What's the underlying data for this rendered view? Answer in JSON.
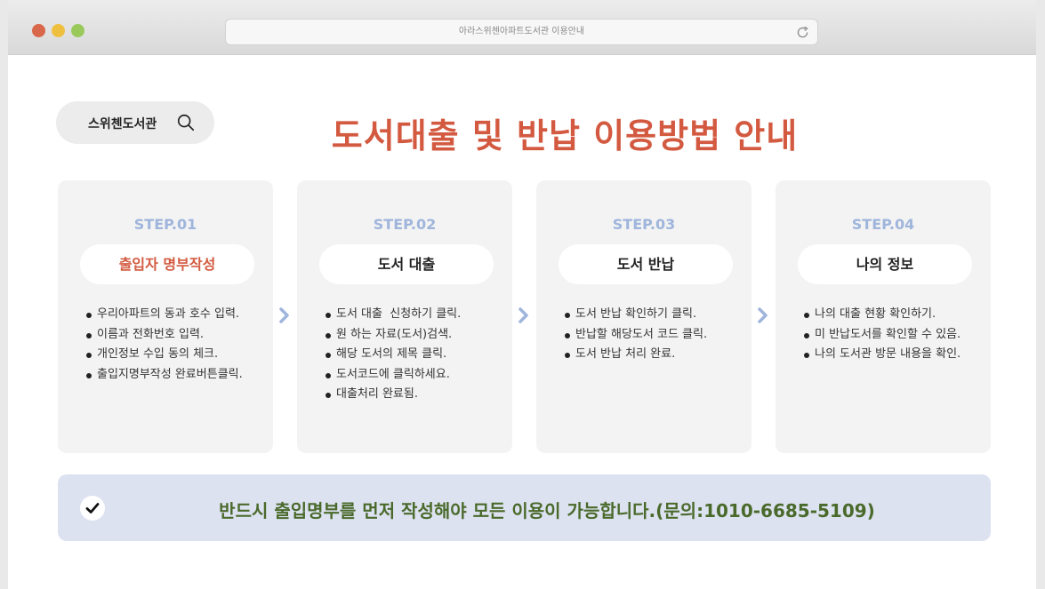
{
  "window": {
    "url_title": "아라스위첸아파트도서관 이용안내",
    "reload_icon": "reload-icon"
  },
  "search": {
    "label": "스위첸도서관",
    "icon": "search-icon"
  },
  "page_title": "도서대출 및 반납 이용방법 안내",
  "steps": [
    {
      "step_label": "STEP.01",
      "title": "출입자 명부작성",
      "items": [
        "우리아파트의 동과 호수 입력.",
        "이름과 전화번호 입력.",
        "개인정보 수입 동의 체크.",
        "출입지명부작성 완료버튼클릭."
      ]
    },
    {
      "step_label": "STEP.02",
      "title": "도서 대출",
      "items": [
        "도서 대출  신청하기 클릭.",
        "원 하는 자료(도서)검색.",
        "해당 도서의 제목 클릭.",
        "도서코드에 클릭하세요.",
        "대출처리 완료됨."
      ]
    },
    {
      "step_label": "STEP.03",
      "title": "도서 반납",
      "items": [
        "도서 반납 확인하기 클릭.",
        "반납할 해당도서 코드 클릭.",
        "도서 반납 처리 완료."
      ]
    },
    {
      "step_label": "STEP.04",
      "title": "나의 정보",
      "items": [
        "나의 대출 현황 확인하기.",
        "미 반납도서를 확인할 수 있음.",
        "나의 도서관 방문 내용을 확인."
      ]
    }
  ],
  "notice": {
    "icon": "check-circle-icon",
    "text": "반드시 출입명부를 먼저 작성해야 모든 이용이 가능합니다.(문의:1010-6685-5109)"
  },
  "colors": {
    "title_accent": "#d35a40",
    "step_label": "#9fb5dc",
    "notice_bg": "#dde2f1",
    "notice_text": "#4a6a2b"
  }
}
